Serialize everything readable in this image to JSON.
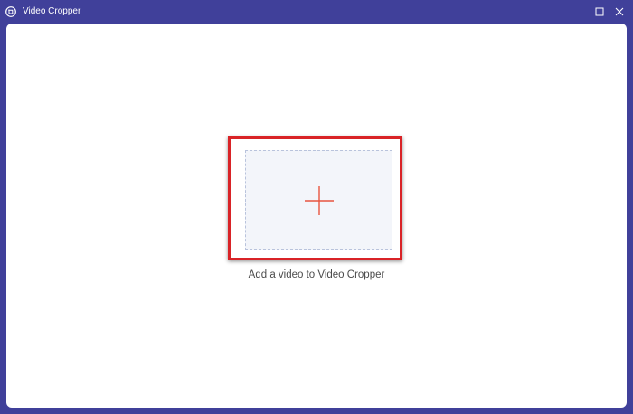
{
  "window": {
    "title": "Video Cropper",
    "icons": {
      "app": "video-cropper-app-icon",
      "maximize": "maximize-icon",
      "close": "close-icon"
    }
  },
  "main": {
    "drop_zone_icon": "plus-icon",
    "add_label": "Add a video to Video Cropper"
  },
  "colors": {
    "frame": "#40409a",
    "highlight": "#d92327",
    "plus": "#e8553f",
    "drop_zone_bg": "#f3f5fa"
  }
}
